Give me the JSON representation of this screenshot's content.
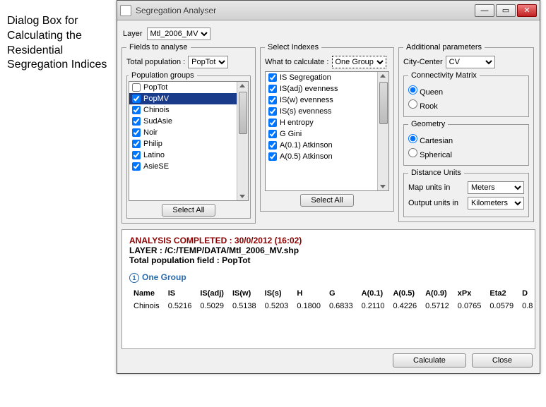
{
  "caption": "Dialog Box for Calculating the Residential Segregation Indices",
  "window": {
    "title": "Segregation Analyser"
  },
  "layer": {
    "label": "Layer",
    "value": "Mtl_2006_MV"
  },
  "fields": {
    "legend": "Fields to analyse",
    "totalpop_label": "Total population :",
    "totalpop_value": "PopTot",
    "groups_legend": "Population groups",
    "groups": [
      {
        "name": "PopTot",
        "checked": false,
        "selected": false
      },
      {
        "name": "PopMV",
        "checked": true,
        "selected": true
      },
      {
        "name": "Chinois",
        "checked": true,
        "selected": false
      },
      {
        "name": "SudAsie",
        "checked": true,
        "selected": false
      },
      {
        "name": "Noir",
        "checked": true,
        "selected": false
      },
      {
        "name": "Philip",
        "checked": true,
        "selected": false
      },
      {
        "name": "Latino",
        "checked": true,
        "selected": false
      },
      {
        "name": "AsieSE",
        "checked": true,
        "selected": false
      }
    ],
    "select_all": "Select All"
  },
  "indexes": {
    "legend": "Select Indexes",
    "calc_label": "What to calculate :",
    "calc_value": "One Group",
    "items": [
      {
        "name": "IS Segregation",
        "checked": true
      },
      {
        "name": "IS(adj) evenness",
        "checked": true
      },
      {
        "name": "IS(w) evenness",
        "checked": true
      },
      {
        "name": "IS(s) evenness",
        "checked": true
      },
      {
        "name": "H entropy",
        "checked": true
      },
      {
        "name": "G Gini",
        "checked": true
      },
      {
        "name": "A(0.1) Atkinson",
        "checked": true
      },
      {
        "name": "A(0.5) Atkinson",
        "checked": true
      }
    ],
    "select_all": "Select All"
  },
  "params": {
    "legend": "Additional parameters",
    "cc_label": "City-Center",
    "cc_value": "CV",
    "conn_legend": "Connectivity Matrix",
    "conn_queen": "Queen",
    "conn_rook": "Rook",
    "geom_legend": "Geometry",
    "geom_cart": "Cartesian",
    "geom_sph": "Spherical",
    "dist_legend": "Distance Units",
    "mapu_label": "Map units in",
    "mapu_value": "Meters",
    "outu_label": "Output units in",
    "outu_value": "Kilometers"
  },
  "output": {
    "completed": "ANALYSIS COMPLETED : 30/0/2012 (16:02)",
    "layer_line": "LAYER : /C:/TEMP/DATA/Mtl_2006_MV.shp",
    "tpf_line": "Total population field : PopTot",
    "section_num": "1",
    "section": "One Group",
    "cols": [
      "Name",
      "IS",
      "IS(adj)",
      "IS(w)",
      "IS(s)",
      "H",
      "G",
      "A(0.1)",
      "A(0.5)",
      "A(0.9)",
      "xPx",
      "Eta2",
      "D"
    ],
    "row0": [
      "Chinois",
      "0.5216",
      "0.5029",
      "0.5138",
      "0.5203",
      "0.1800",
      "0.6833",
      "0.2110",
      "0.4226",
      "0.5712",
      "0.0765",
      "0.0579",
      "0.8"
    ]
  },
  "footer": {
    "calculate": "Calculate",
    "close": "Close"
  }
}
